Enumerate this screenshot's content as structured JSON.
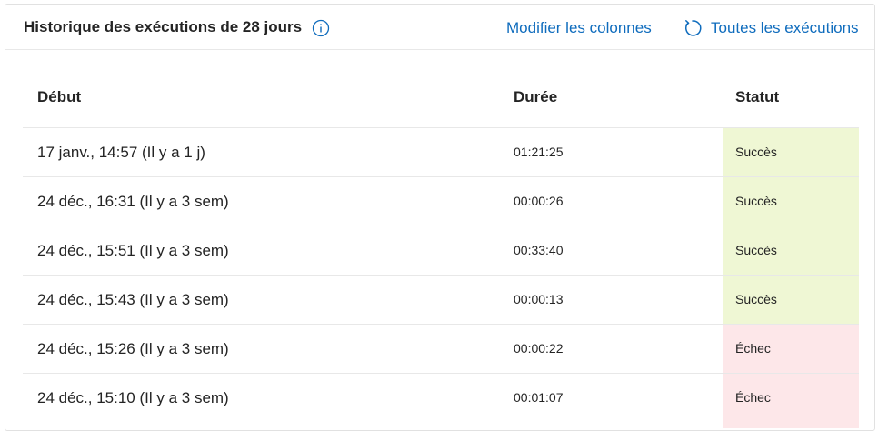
{
  "header": {
    "title": "Historique des exécutions de 28 jours",
    "edit_columns_label": "Modifier les colonnes",
    "all_runs_label": "Toutes les exécutions"
  },
  "icons": {
    "info": "info-icon",
    "refresh": "refresh-icon"
  },
  "colors": {
    "link": "#0f6cbd",
    "success_bg": "#eff7d4",
    "failure_bg": "#fde7e9"
  },
  "table": {
    "columns": [
      "Début",
      "Durée",
      "Statut"
    ],
    "rows": [
      {
        "start": "17 janv., 14:57 (Il y a 1 j)",
        "duration": "01:21:25",
        "status": "Succès",
        "state": "success"
      },
      {
        "start": "24 déc., 16:31 (Il y a 3 sem)",
        "duration": "00:00:26",
        "status": "Succès",
        "state": "success"
      },
      {
        "start": "24 déc., 15:51 (Il y a 3 sem)",
        "duration": "00:33:40",
        "status": "Succès",
        "state": "success"
      },
      {
        "start": "24 déc., 15:43 (Il y a 3 sem)",
        "duration": "00:00:13",
        "status": "Succès",
        "state": "success"
      },
      {
        "start": "24 déc., 15:26 (Il y a 3 sem)",
        "duration": "00:00:22",
        "status": "Échec",
        "state": "fail"
      },
      {
        "start": "24 déc., 15:10 (Il y a 3 sem)",
        "duration": "00:01:07",
        "status": "Échec",
        "state": "fail"
      }
    ]
  }
}
